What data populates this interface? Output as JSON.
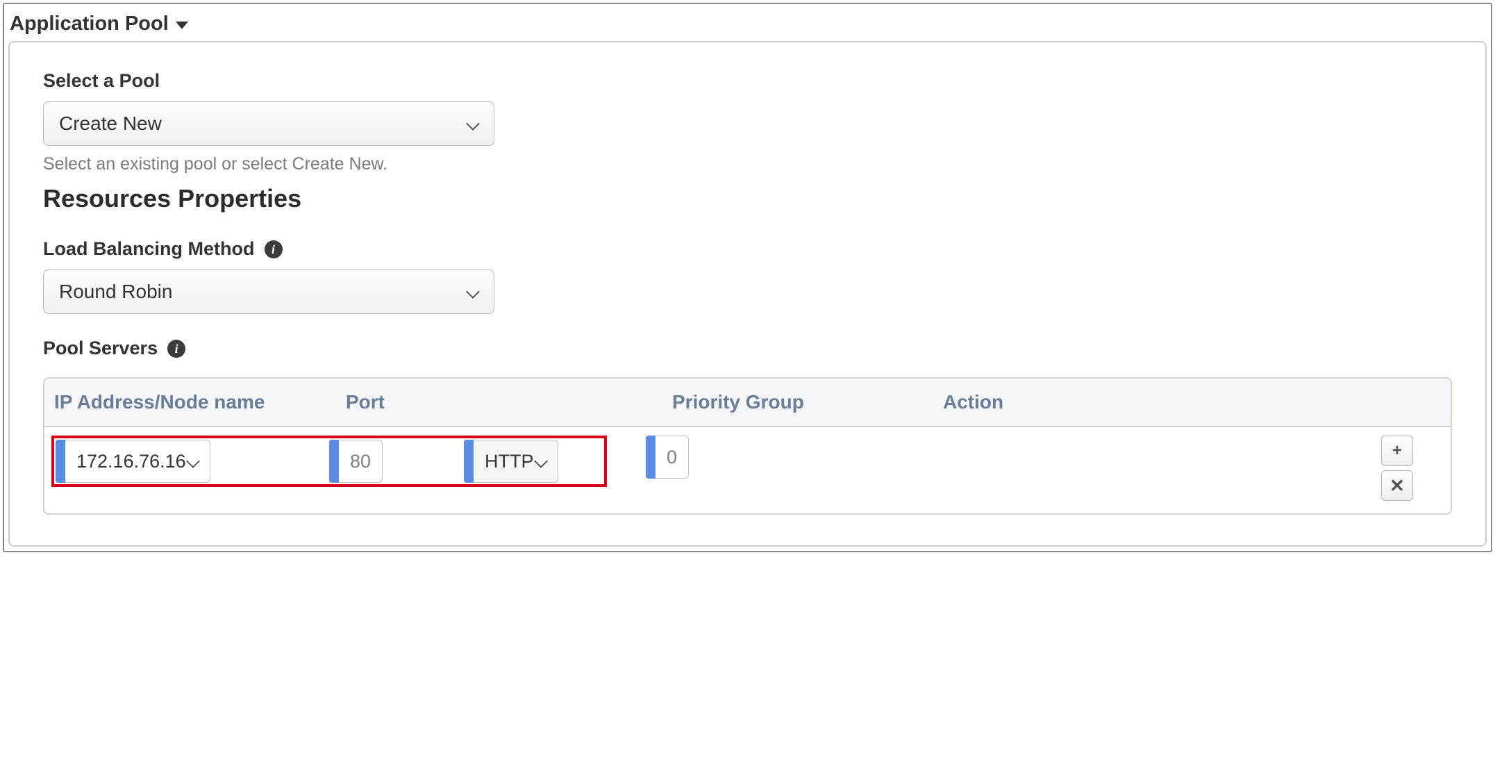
{
  "header": {
    "title": "Application Pool"
  },
  "pool_select": {
    "label": "Select a Pool",
    "value": "Create New",
    "help": "Select an existing pool or select Create New."
  },
  "resources": {
    "heading": "Resources Properties",
    "lb_method": {
      "label": "Load Balancing Method",
      "value": "Round Robin"
    },
    "pool_servers": {
      "label": "Pool Servers",
      "columns": {
        "ip": "IP Address/Node name",
        "port": "Port",
        "pg": "Priority Group",
        "action": "Action"
      },
      "rows": [
        {
          "ip": "172.16.76.16",
          "port": "80",
          "protocol": "HTTP",
          "priority_group": "0"
        }
      ]
    }
  },
  "icons": {
    "info": "i",
    "plus": "+",
    "close": "✕"
  }
}
